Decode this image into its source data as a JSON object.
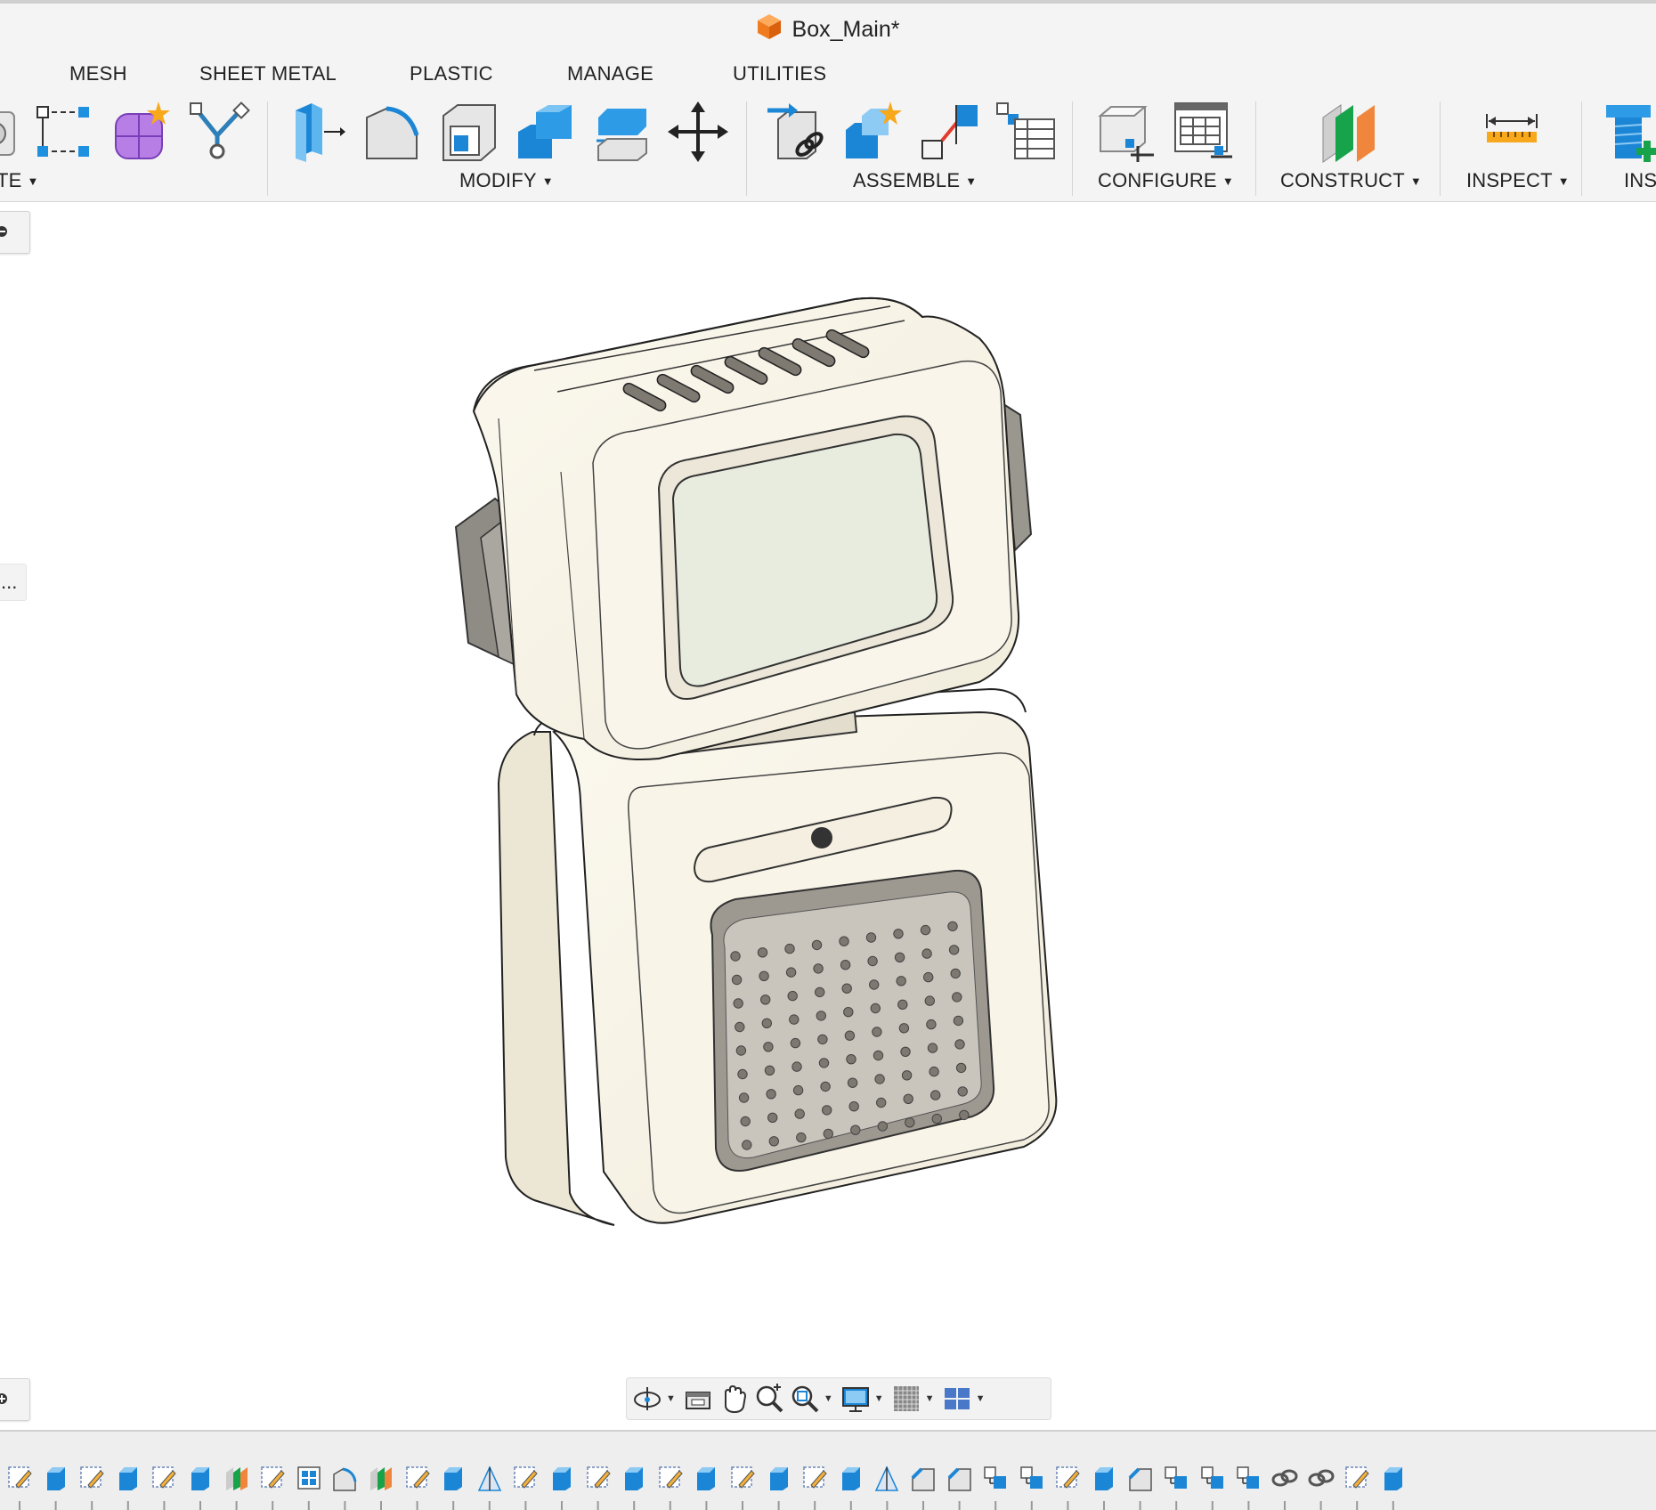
{
  "window": {
    "title": "Box_Main*",
    "title_icon": "orange-cube-icon",
    "accent_color": "#f07b1f"
  },
  "tabs": [
    {
      "label": "MESH"
    },
    {
      "label": "SHEET METAL"
    },
    {
      "label": "PLASTIC"
    },
    {
      "label": "MANAGE"
    },
    {
      "label": "UTILITIES"
    }
  ],
  "toolbar": {
    "groups": {
      "create_partial": "TE",
      "modify": "MODIFY",
      "assemble": "ASSEMBLE",
      "configure": "CONFIGURE",
      "construct": "CONSTRUCT",
      "inspect": "INSPECT",
      "insert_partial": "INS"
    },
    "tools": {
      "create": [
        "partial-box-icon",
        "sketch-constraint-icon",
        "form-icon",
        "derive-icon"
      ],
      "modify": [
        "press-pull-icon",
        "fillet-icon",
        "shell-icon",
        "combine-icon",
        "offset-face-icon",
        "move-copy-icon"
      ],
      "assemble": [
        "joint-icon",
        "new-component-icon",
        "as-built-joint-icon",
        "bill-of-materials-icon"
      ],
      "configure": [
        "configure-model-icon",
        "configuration-table-icon"
      ],
      "construct": [
        "offset-plane-icon"
      ],
      "inspect": [
        "measure-icon"
      ],
      "insert": [
        "insert-fastener-icon"
      ]
    }
  },
  "left_panel": {
    "collapsed_indicator": "..."
  },
  "navigation_bar": {
    "tools": [
      "orbit-icon",
      "look-at-icon",
      "pan-icon",
      "zoom-icon",
      "fit-icon",
      "display-settings-icon",
      "grid-icon",
      "viewports-icon"
    ]
  },
  "timeline": {
    "feature_icons": [
      "sketch-icon",
      "extrude-icon",
      "sketch-icon",
      "extrude-icon",
      "sketch-icon",
      "extrude-icon",
      "offset-plane-icon",
      "sketch-icon",
      "insert-icon",
      "fillet-icon",
      "offset-plane-icon",
      "sketch-icon",
      "extrude-icon",
      "draft-icon",
      "sketch-icon",
      "extrude-icon",
      "sketch-icon",
      "extrude-icon",
      "sketch-icon",
      "extrude-icon",
      "sketch-icon",
      "extrude-icon",
      "sketch-icon",
      "extrude-icon",
      "draft-icon",
      "chamfer-icon",
      "chamfer-icon",
      "combine-icon",
      "combine-icon",
      "sketch-icon",
      "extrude-icon",
      "chamfer-icon",
      "combine-icon",
      "combine-icon",
      "combine-icon",
      "joint-icon",
      "joint-icon",
      "sketch-icon",
      "extrude-icon"
    ]
  }
}
